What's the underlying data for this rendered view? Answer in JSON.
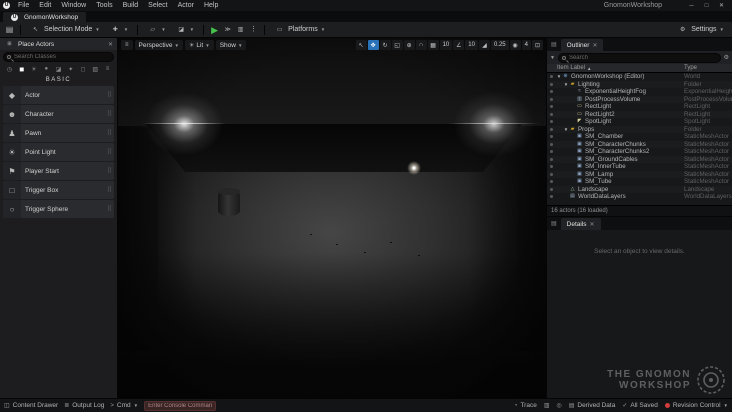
{
  "menubar": {
    "menus": [
      "File",
      "Edit",
      "Window",
      "Tools",
      "Build",
      "Select",
      "Actor",
      "Help"
    ],
    "window_title": "GnomonWorkshop"
  },
  "tabbar": {
    "active_tab": "GnomonWorkshop"
  },
  "toolbar": {
    "selection_mode": "Selection Mode",
    "platforms": "Platforms",
    "settings": "Settings"
  },
  "place_actors": {
    "title": "Place Actors",
    "search_placeholder": "Search Classes",
    "section_label": "BASIC",
    "items": [
      {
        "label": "Actor",
        "icon": "◆"
      },
      {
        "label": "Character",
        "icon": "☻"
      },
      {
        "label": "Pawn",
        "icon": "♟"
      },
      {
        "label": "Point Light",
        "icon": "☀"
      },
      {
        "label": "Player Start",
        "icon": "⚑"
      },
      {
        "label": "Trigger Box",
        "icon": "□"
      },
      {
        "label": "Trigger Sphere",
        "icon": "○"
      }
    ]
  },
  "viewport": {
    "camera_mode": "Perspective",
    "view_mode": "Lit",
    "show_label": "Show",
    "grid_snap": "10",
    "angle_snap": "10",
    "scale_snap": "0.25",
    "camera_speed": "4"
  },
  "outliner": {
    "tab": "Outliner",
    "search_placeholder": "Search",
    "col_item_label": "Item Label",
    "col_type": "Type",
    "footer": "16 actors (16 loaded)",
    "rows": [
      {
        "label": "GnomonWorkshop (Editor)",
        "type": "World",
        "level": 0,
        "expanded": true,
        "kind": "world"
      },
      {
        "label": "Lighting",
        "type": "Folder",
        "level": 1,
        "expanded": true,
        "kind": "folder"
      },
      {
        "label": "ExponentialHeightFog",
        "type": "ExponentialHeightFog",
        "level": 2,
        "kind": "fog"
      },
      {
        "label": "PostProcessVolume",
        "type": "PostProcessVolume",
        "level": 2,
        "kind": "volume"
      },
      {
        "label": "RectLight",
        "type": "RectLight",
        "level": 2,
        "kind": "rectlight"
      },
      {
        "label": "RectLight2",
        "type": "RectLight",
        "level": 2,
        "kind": "rectlight"
      },
      {
        "label": "SpotLight",
        "type": "SpotLight",
        "level": 2,
        "kind": "spotlight"
      },
      {
        "label": "Props",
        "type": "Folder",
        "level": 1,
        "expanded": true,
        "kind": "folder"
      },
      {
        "label": "SM_Chamber",
        "type": "StaticMeshActor",
        "level": 2,
        "kind": "mesh"
      },
      {
        "label": "SM_CharacterChunks",
        "type": "StaticMeshActor",
        "level": 2,
        "kind": "mesh"
      },
      {
        "label": "SM_CharacterChunks2",
        "type": "StaticMeshActor",
        "level": 2,
        "kind": "mesh"
      },
      {
        "label": "SM_GroundCables",
        "type": "StaticMeshActor",
        "level": 2,
        "kind": "mesh"
      },
      {
        "label": "SM_InnerTube",
        "type": "StaticMeshActor",
        "level": 2,
        "kind": "mesh"
      },
      {
        "label": "SM_Lamp",
        "type": "StaticMeshActor",
        "level": 2,
        "kind": "mesh"
      },
      {
        "label": "SM_Tube",
        "type": "StaticMeshActor",
        "level": 2,
        "kind": "mesh"
      },
      {
        "label": "Landscape",
        "type": "Landscape",
        "level": 1,
        "kind": "landscape"
      },
      {
        "label": "WorldDataLayers",
        "type": "WorldDataLayers",
        "level": 1,
        "kind": "layers"
      }
    ]
  },
  "icons": {
    "world": {
      "glyph": "⊕",
      "color": "#79a7d9"
    },
    "folder": {
      "glyph": "▰",
      "color": "#c9a227"
    },
    "fog": {
      "glyph": "≈",
      "color": "#9fb3c8"
    },
    "volume": {
      "glyph": "▥",
      "color": "#9fb3c8"
    },
    "rectlight": {
      "glyph": "▭",
      "color": "#d6cf9e"
    },
    "spotlight": {
      "glyph": "◤",
      "color": "#d6cf9e"
    },
    "mesh": {
      "glyph": "▣",
      "color": "#8da6c4"
    },
    "landscape": {
      "glyph": "△",
      "color": "#9cc49c"
    },
    "layers": {
      "glyph": "▤",
      "color": "#9fb3c8"
    }
  },
  "details": {
    "tab": "Details",
    "empty_message": "Select an object to view details."
  },
  "statusbar": {
    "content_drawer": "Content Drawer",
    "output_log": "Output Log",
    "cmd": "Cmd",
    "console_placeholder": "Enter Console Command",
    "trace": "Trace",
    "derived_data": "Derived Data",
    "all_saved": "All Saved",
    "revision_control": "Revision Control"
  },
  "watermark": {
    "line1": "THE GNOMON",
    "line2": "WORKSHOP"
  }
}
